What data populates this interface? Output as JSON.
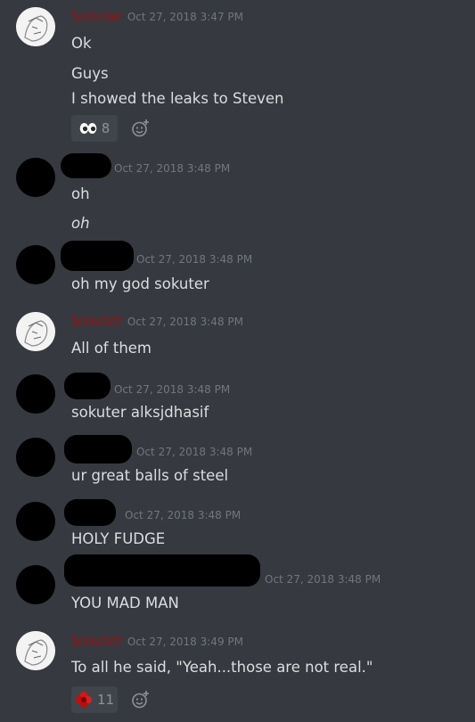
{
  "messages": [
    {
      "author": "Sokuter",
      "timestamp": "Oct 27, 2018 3:47 PM",
      "lines": [
        "Ok",
        "Guys",
        "I showed the leaks to Steven"
      ],
      "reaction": {
        "emoji": "eyes",
        "count": "8"
      }
    },
    {
      "author": "",
      "timestamp": "Oct 27, 2018 3:48 PM",
      "lines": [
        "oh",
        "oh"
      ]
    },
    {
      "author": "",
      "timestamp": "Oct 27, 2018 3:48 PM",
      "lines": [
        "oh my god sokuter"
      ]
    },
    {
      "author": "Sokuter",
      "timestamp": "Oct 27, 2018 3:48 PM",
      "lines": [
        "All of them"
      ]
    },
    {
      "author": "",
      "timestamp": "Oct 27, 2018 3:48 PM",
      "lines": [
        "sokuter alksjdhasif"
      ]
    },
    {
      "author": "",
      "timestamp": "Oct 27, 2018 3:48 PM",
      "lines": [
        "ur great balls of steel"
      ]
    },
    {
      "author": "",
      "timestamp": "Oct 27, 2018 3:48 PM",
      "lines": [
        "HOLY FUDGE"
      ]
    },
    {
      "author": "",
      "timestamp": "Oct 27, 2018 3:48 PM",
      "lines": [
        "YOU MAD MAN"
      ]
    },
    {
      "author": "Sokuter",
      "timestamp": "Oct 27, 2018 3:49 PM",
      "lines": [
        "To all he said, \"Yeah...those are not real.\""
      ],
      "reaction": {
        "emoji": "red-flower",
        "count": "11"
      }
    }
  ],
  "colors": {
    "background": "#36393f",
    "author": "#9a1111",
    "timestamp": "#72767d",
    "text": "#dcddde",
    "reaction_bg": "#40444b"
  }
}
